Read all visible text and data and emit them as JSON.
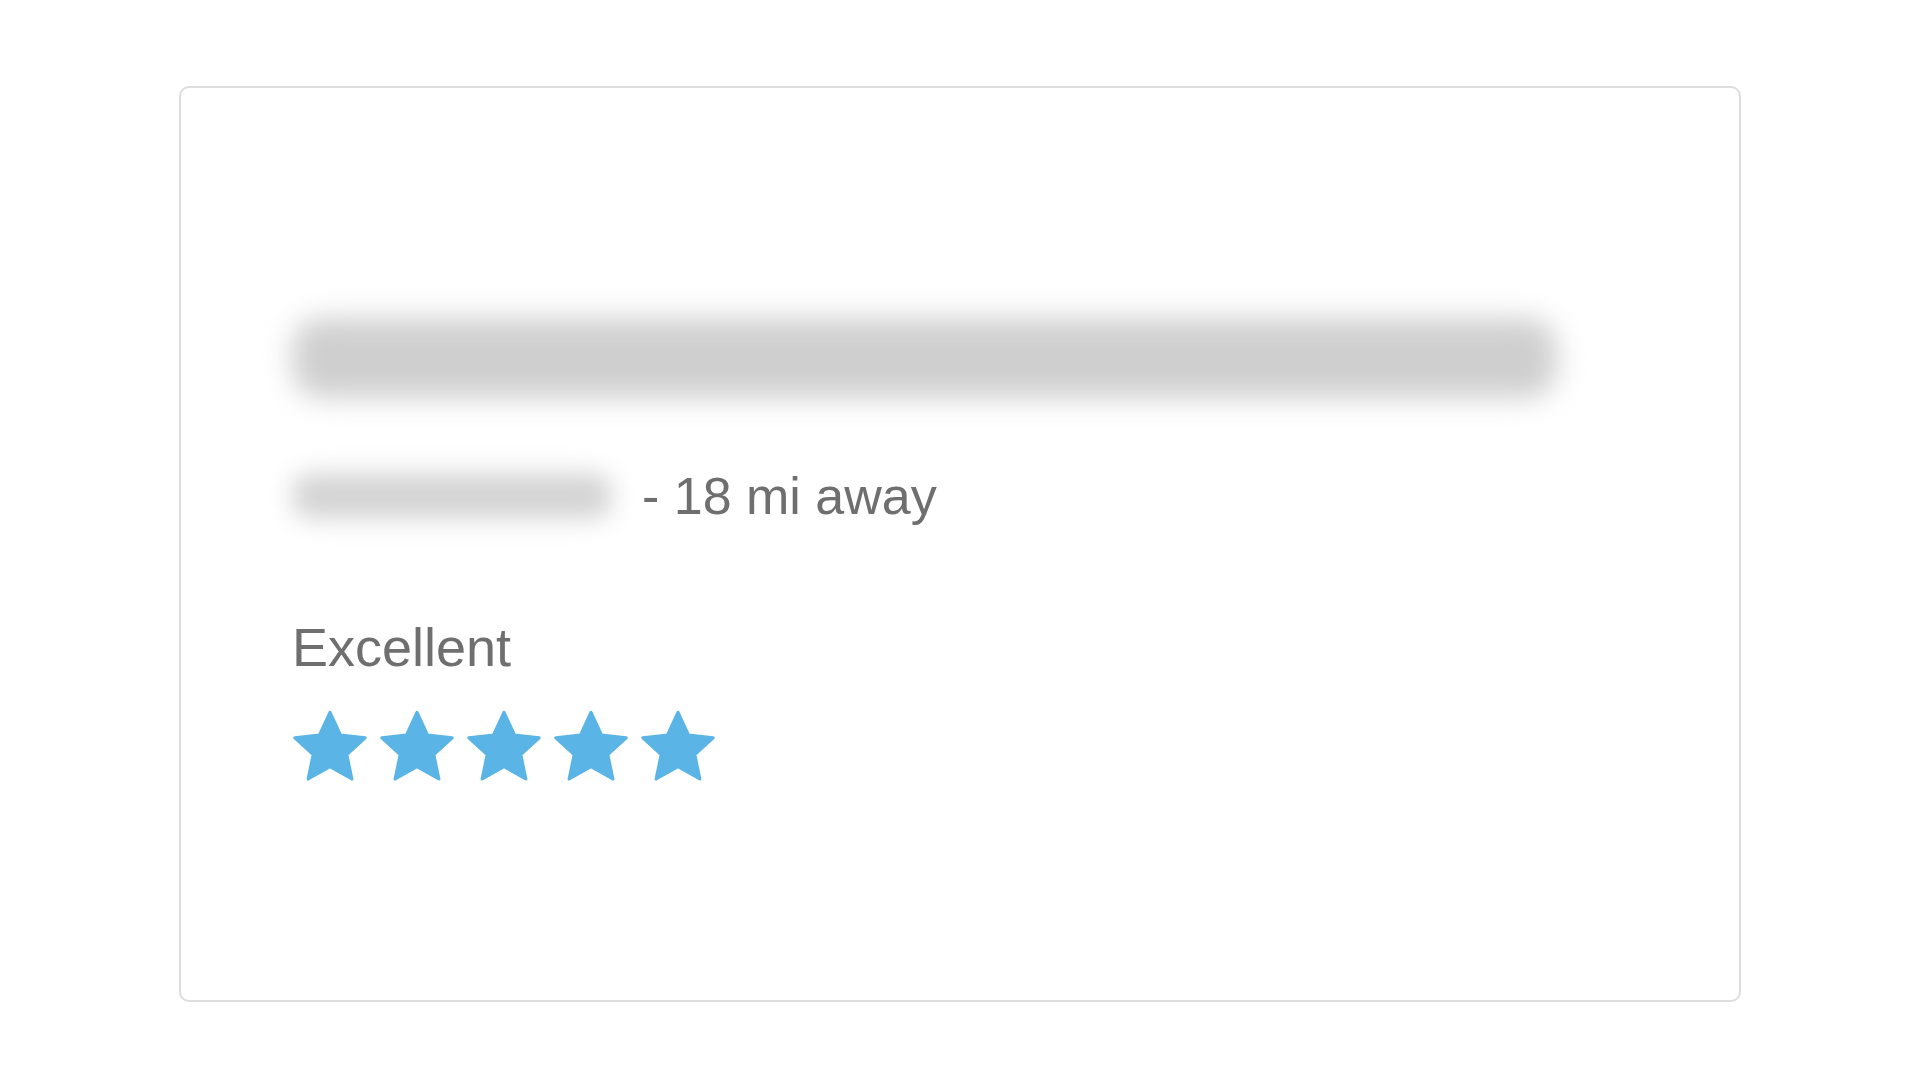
{
  "listing": {
    "distance": "- 18 mi away",
    "rating_label": "Excellent",
    "stars": 5
  }
}
